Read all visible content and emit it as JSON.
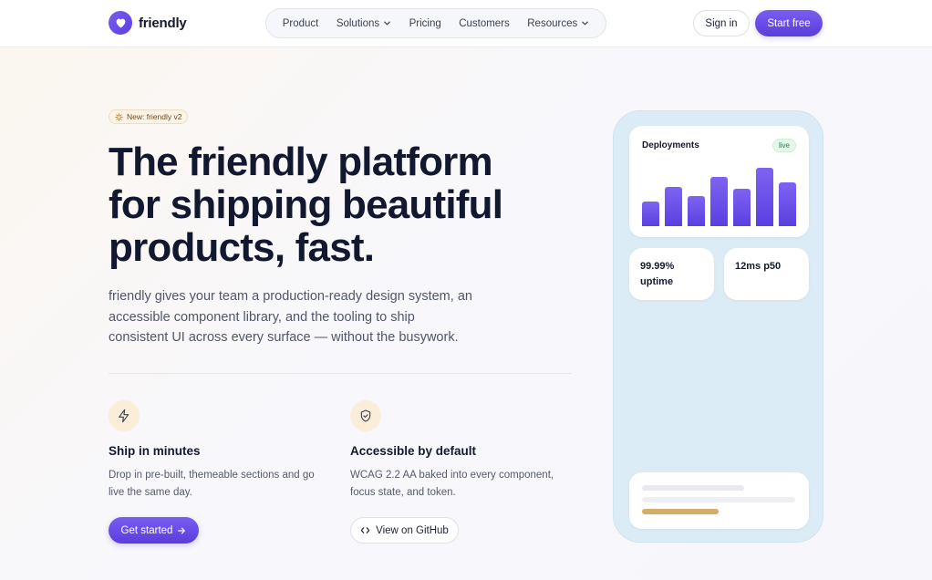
{
  "nav": {
    "brand": "friendly",
    "items": [
      {
        "label": "Product",
        "dropdown": false
      },
      {
        "label": "Solutions",
        "dropdown": true
      },
      {
        "label": "Pricing",
        "dropdown": false
      },
      {
        "label": "Customers",
        "dropdown": false
      },
      {
        "label": "Resources",
        "dropdown": true
      }
    ],
    "signin_label": "Sign in",
    "start_label": "Start free"
  },
  "hero": {
    "badge": "New: friendly v2",
    "headline_lines": [
      "The friendly platform",
      "for shipping beautiful",
      "products, fast."
    ],
    "lede_lines": [
      "friendly gives your team a production-ready design system, an",
      "accessible component library, and the tooling to ship",
      "consistent UI across every surface — without the busywork."
    ]
  },
  "features": [
    {
      "icon": "lightning-icon",
      "title": "Ship in minutes",
      "text_lines": [
        "Drop in pre-built, themeable sections and go",
        "live the same day."
      ]
    },
    {
      "icon": "shield-check-icon",
      "title": "Accessible by default",
      "text_lines": [
        "WCAG 2.2 AA baked into every component,",
        "focus state, and token."
      ]
    }
  ],
  "cta": {
    "primary_label": "Get started",
    "secondary_label": "View on GitHub"
  },
  "panel": {
    "deploy_title": "Deployments",
    "status_badge": "live",
    "deploy_bars": [
      0.38,
      0.62,
      0.47,
      0.77,
      0.58,
      0.91,
      0.68
    ],
    "metrics": [
      {
        "lines": [
          "99.99%",
          "uptime"
        ]
      },
      {
        "lines": [
          "12ms p50"
        ]
      }
    ]
  },
  "colors": {
    "accent": "#5b3fe0",
    "accent_light": "#7c5cf0",
    "panel_bg": "#dcecf6",
    "badge_bg": "#fdf4e6",
    "live_bg": "#e6f6ec",
    "progress_gold": "#d4ad6a"
  }
}
